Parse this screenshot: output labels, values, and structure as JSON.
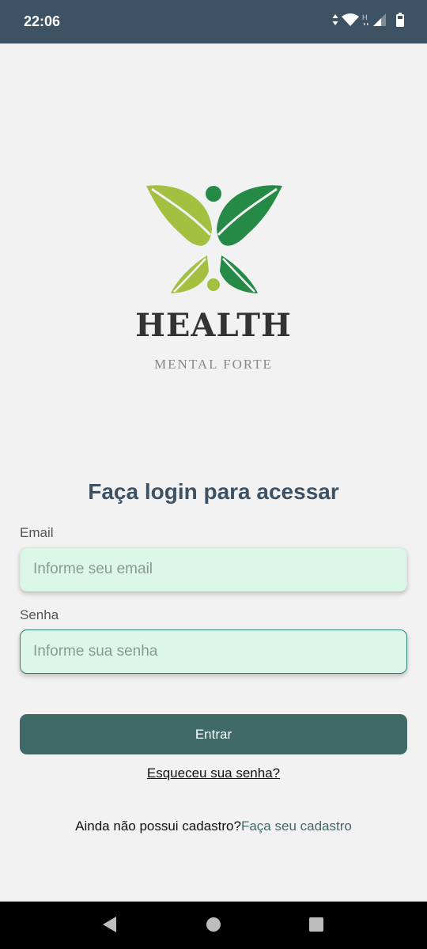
{
  "status_bar": {
    "time": "22:06",
    "icons": [
      "data-arrows-icon",
      "wifi-icon",
      "network-h-icon",
      "signal-icon",
      "battery-icon"
    ]
  },
  "branding": {
    "logo_icon": "butterfly-leaf-logo",
    "title": "HEALTH",
    "subtitle": "MENTAL FORTE",
    "colors": {
      "leaf_light": "#a3c041",
      "leaf_dark": "#258a45"
    }
  },
  "login": {
    "heading": "Faça login para acessar",
    "email_label": "Email",
    "email_placeholder": "Informe seu email",
    "email_value": "",
    "password_label": "Senha",
    "password_placeholder": "Informe sua senha",
    "password_value": "",
    "submit_label": "Entrar",
    "forgot_link": "Esqueceu sua senha?",
    "signup_prompt": "Ainda não possui cadastro?",
    "signup_link": "Faça seu cadastro"
  },
  "colors": {
    "status_bar": "#3d5263",
    "primary": "#3f6a67",
    "field_bg": "#dbf7e7",
    "heading": "#3d5263"
  },
  "nav_bar": {
    "icons": [
      "back-triangle-icon",
      "home-circle-icon",
      "recents-square-icon"
    ]
  }
}
